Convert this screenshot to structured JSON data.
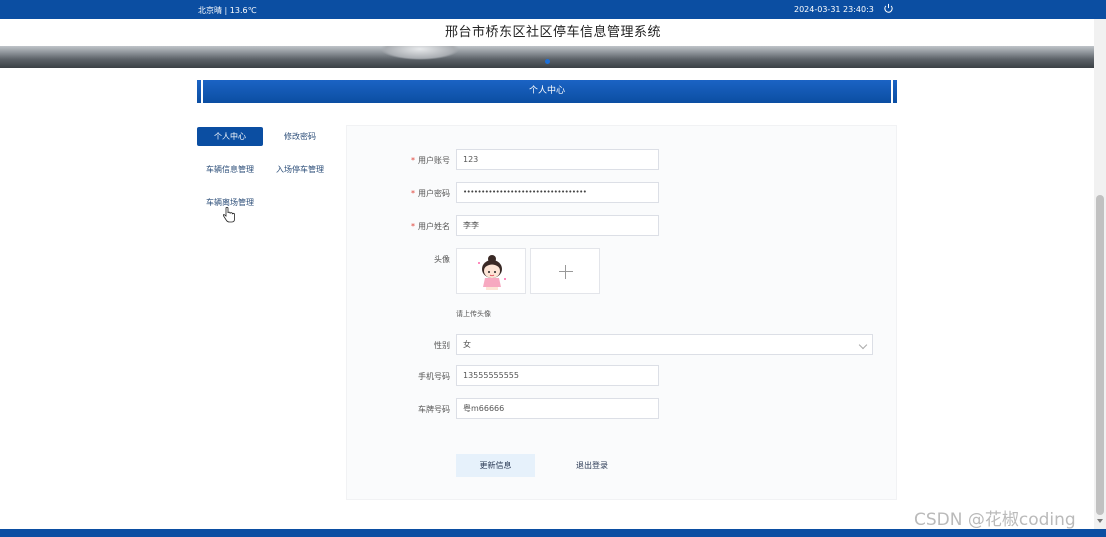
{
  "topbar": {
    "weather": "北京晴 | 13.6℃",
    "datetime": "2024-03-31  23:40:3",
    "power_icon": "power-icon"
  },
  "header": {
    "title": "邢台市桥东区社区停车信息管理系统"
  },
  "section": {
    "title": "个人中心"
  },
  "sidebar": {
    "items": [
      {
        "label": "个人中心",
        "active": true
      },
      {
        "label": "修改密码",
        "active": false
      },
      {
        "label": "车辆信息管理",
        "active": false
      },
      {
        "label": "入场停车管理",
        "active": false
      },
      {
        "label": "车辆离场管理",
        "active": false
      }
    ]
  },
  "form": {
    "fields": {
      "account": {
        "label": "用户账号",
        "required": true,
        "value": "123"
      },
      "password": {
        "label": "用户密码",
        "required": true,
        "value": "••••••••••••••••••••••••••••••••••"
      },
      "name": {
        "label": "用户姓名",
        "required": true,
        "value": "李李"
      },
      "avatar": {
        "label": "头像",
        "hint": "请上传头像"
      },
      "gender": {
        "label": "性别",
        "value": "女"
      },
      "phone": {
        "label": "手机号码",
        "value": "13555555555"
      },
      "plate": {
        "label": "车牌号码",
        "value": "粤m66666"
      }
    },
    "buttons": {
      "update": "更新信息",
      "logout": "退出登录"
    }
  },
  "watermark": "CSDN @花椒coding",
  "colors": {
    "primary": "#0b4ea2",
    "required": "#e0443a",
    "update_button_bg": "#e6f1fb"
  }
}
